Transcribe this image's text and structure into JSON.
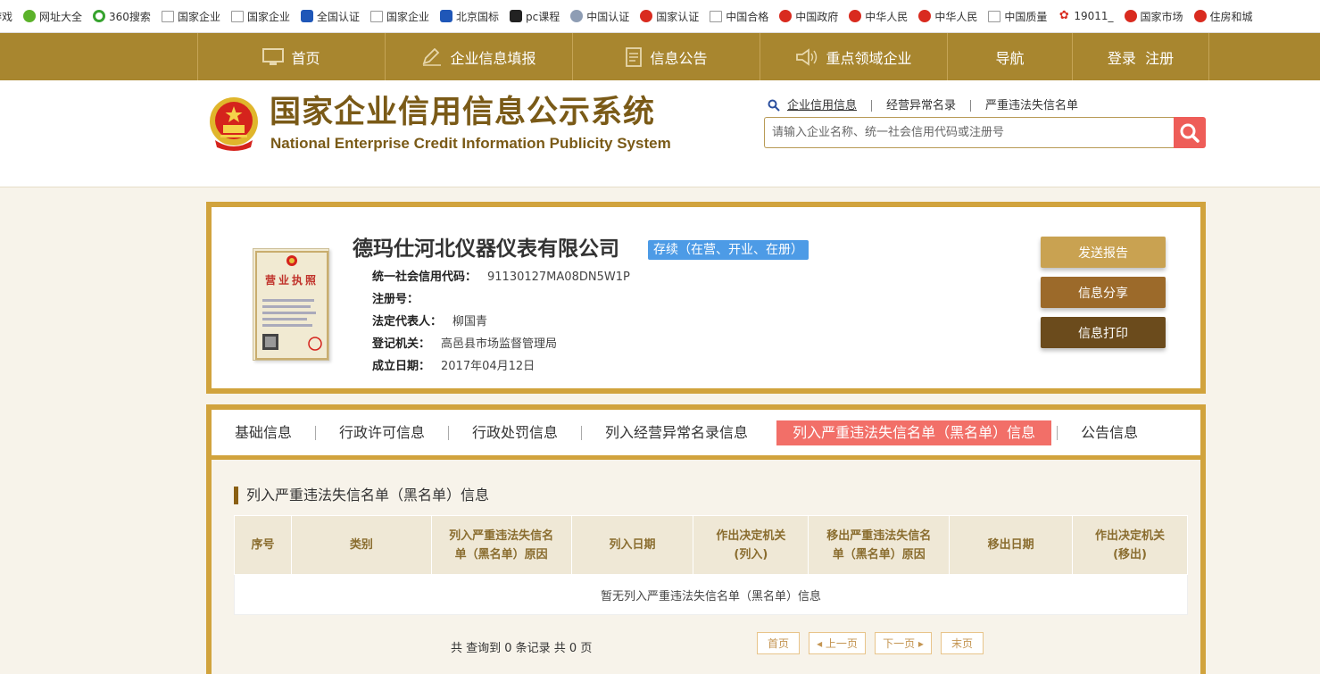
{
  "bookmarks": [
    {
      "label": "游戏",
      "icon": "page-icon"
    },
    {
      "label": "网址大全",
      "icon": "green-plus-icon"
    },
    {
      "label": "360搜索",
      "icon": "360-icon"
    },
    {
      "label": "国家企业",
      "icon": "page-icon"
    },
    {
      "label": "国家企业",
      "icon": "page-icon"
    },
    {
      "label": "全国认证",
      "icon": "blue-logo-icon"
    },
    {
      "label": "国家企业",
      "icon": "page-icon"
    },
    {
      "label": "北京国标",
      "icon": "blue-logo-icon"
    },
    {
      "label": "pc课程",
      "icon": "black-logo-icon"
    },
    {
      "label": "中国认证",
      "icon": "grey-globe-icon"
    },
    {
      "label": "国家认证",
      "icon": "red-emblem-icon"
    },
    {
      "label": "中国合格",
      "icon": "page-icon"
    },
    {
      "label": "中国政府",
      "icon": "red-emblem-icon"
    },
    {
      "label": "中华人民",
      "icon": "red-emblem-icon"
    },
    {
      "label": "中华人民",
      "icon": "red-emblem-icon"
    },
    {
      "label": "中国质量",
      "icon": "page-icon"
    },
    {
      "label": "19011_",
      "icon": "red-logo-icon"
    },
    {
      "label": "国家市场",
      "icon": "red-emblem-icon"
    },
    {
      "label": "住房和城",
      "icon": "red-emblem-icon"
    }
  ],
  "nav": {
    "items": [
      "首页",
      "企业信息填报",
      "信息公告",
      "重点领域企业",
      "导航",
      "登录  注册"
    ]
  },
  "header": {
    "title_cn": "国家企业信用信息公示系统",
    "title_en": "National Enterprise Credit Information Publicity System",
    "search_tabs": [
      "企业信用信息",
      "经营异常名录",
      "严重违法失信名单"
    ],
    "search_placeholder": "请输入企业名称、统一社会信用代码或注册号"
  },
  "company": {
    "name": "德玛仕河北仪器仪表有限公司",
    "status": "存续（在营、开业、在册）",
    "fields": [
      {
        "label": "统一社会信用代码：",
        "value": "91130127MA08DN5W1P"
      },
      {
        "label": "注册号：",
        "value": ""
      },
      {
        "label": "法定代表人：",
        "value": "柳国青"
      },
      {
        "label": "登记机关：",
        "value": "高邑县市场监督管理局"
      },
      {
        "label": "成立日期：",
        "value": "2017年04月12日"
      }
    ],
    "license_text": "营业执照",
    "actions": [
      "发送报告",
      "信息分享",
      "信息打印"
    ],
    "action_colors": [
      "#c9a251",
      "#9c6a2a",
      "#6b4b1c"
    ]
  },
  "detail": {
    "tabs": [
      "基础信息",
      "行政许可信息",
      "行政处罚信息",
      "列入经营异常名录信息",
      "列入严重违法失信名单（黑名单）信息",
      "公告信息"
    ],
    "active_tab": 4,
    "section_title": "列入严重违法失信名单（黑名单）信息",
    "columns": [
      "序号",
      "类别",
      "列入严重违法失信名单（黑名单）原因",
      "列入日期",
      "作出决定机关(列入)",
      "移出严重违法失信名单（黑名单）原因",
      "移出日期",
      "作出决定机关(移出)"
    ],
    "empty_text": "暂无列入严重违法失信名单（黑名单）信息",
    "footer_text": "共 查询到 0 条记录 共 0 页",
    "pager": [
      "首页",
      "◂ 上一页",
      "下一页 ▸",
      "末页"
    ]
  },
  "colors": {
    "nav": "#a8862f",
    "accent": "#d1a33d",
    "active_tab": "#f26f68",
    "badge": "#4d9be6",
    "search_button": "#ee5d58"
  }
}
